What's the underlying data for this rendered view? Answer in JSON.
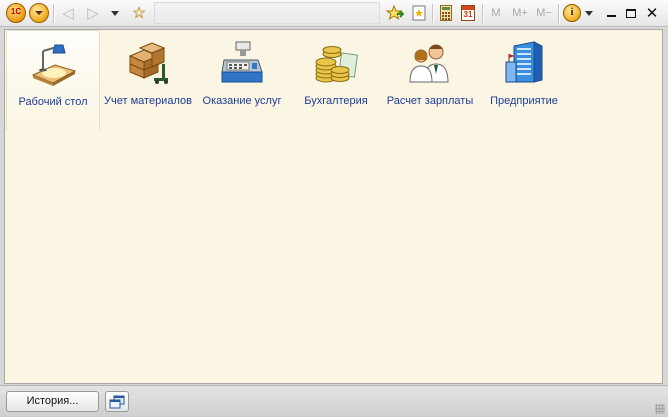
{
  "titlebar": {
    "logo_text": "1С",
    "window_title": "",
    "memory_buttons": [
      "M",
      "M+",
      "M−"
    ],
    "calendar_day": "31"
  },
  "sections": [
    {
      "label": "Рабочий стол",
      "icon": "desk-lamp-icon",
      "active": true
    },
    {
      "label": "Учет материалов",
      "icon": "boxes-pallet-icon",
      "active": false
    },
    {
      "label": "Оказание услуг",
      "icon": "cash-register-icon",
      "active": false
    },
    {
      "label": "Бухгалтерия",
      "icon": "coins-icon",
      "active": false
    },
    {
      "label": "Расчет зарплаты",
      "icon": "employees-icon",
      "active": false
    },
    {
      "label": "Предприятие",
      "icon": "office-building-icon",
      "active": false
    }
  ],
  "statusbar": {
    "history_label": "История..."
  },
  "colors": {
    "content_bg": "#fbf6e3",
    "section_label": "#1f3c99"
  }
}
